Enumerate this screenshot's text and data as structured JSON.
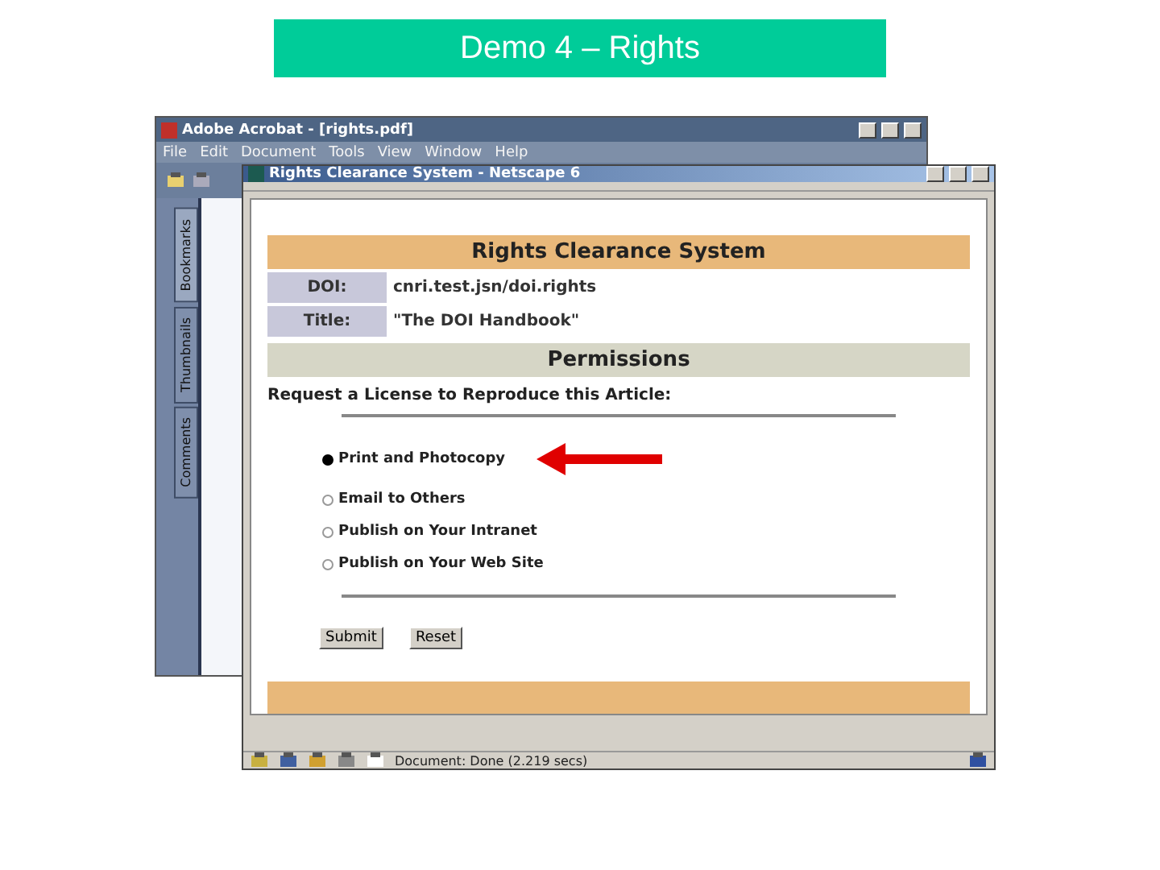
{
  "slide_title": "Demo 4 – Rights",
  "acrobat": {
    "title": "Adobe Acrobat - [rights.pdf]",
    "menu": [
      "File",
      "Edit",
      "Document",
      "Tools",
      "View",
      "Window",
      "Help"
    ],
    "side_tabs": [
      {
        "label": "Bookmarks",
        "selected": true
      },
      {
        "label": "Thumbnails",
        "selected": false
      },
      {
        "label": "Comments",
        "selected": false
      }
    ]
  },
  "browser": {
    "title": "Rights Clearance System - Netscape 6",
    "heading": "Rights Clearance System",
    "fields": [
      {
        "label": "DOI:",
        "value": "cnri.test.jsn/doi.rights"
      },
      {
        "label": "Title:",
        "value": "\"The DOI Handbook\""
      }
    ],
    "section": "Permissions",
    "prompt": "Request a License to Reproduce this Article:",
    "options": [
      {
        "label": "Print and Photocopy",
        "selected": true
      },
      {
        "label": "Email to Others",
        "selected": false
      },
      {
        "label": "Publish on Your Intranet",
        "selected": false
      },
      {
        "label": "Publish on Your Web Site",
        "selected": false
      }
    ],
    "buttons": [
      "Submit",
      "Reset"
    ],
    "status": "Document: Done (2.219 secs)"
  }
}
